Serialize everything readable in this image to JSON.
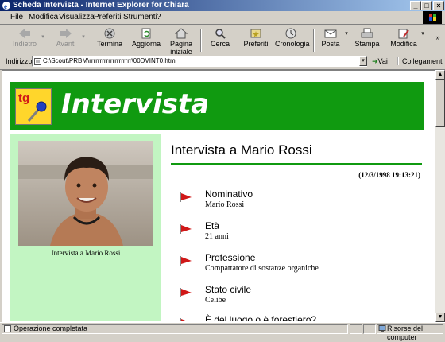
{
  "window": {
    "title": "Scheda Intervista - Internet Explorer for Chiara"
  },
  "menu": [
    "File",
    "Modifica",
    "Visualizza",
    "Preferiti",
    "Strumenti",
    "?"
  ],
  "toolbar": {
    "back": "Indietro",
    "forward": "Avanti",
    "stop": "Termina",
    "refresh": "Aggiorna",
    "home_line1": "Pagina",
    "home_line2": "iniziale",
    "search": "Cerca",
    "favorites": "Preferiti",
    "history": "Cronologia",
    "mail": "Posta",
    "print": "Stampa",
    "edit": "Modifica"
  },
  "address": {
    "label": "Indirizzo",
    "url": "C:\\Scout\\PRBM\\rrrrrrrrrrrrrrrrrrrr\\00DVINT0.htm",
    "go": "Vai",
    "links": "Collegamenti"
  },
  "page": {
    "banner_title": "Intervista",
    "logo_text": "tg",
    "photo_caption": "Intervista a Mario Rossi",
    "heading": "Intervista a Mario Rossi",
    "timestamp": "(12/3/1998 19:13:21)",
    "fields": [
      {
        "label": "Nominativo",
        "value": "Mario Rossi"
      },
      {
        "label": "Età",
        "value": "21 anni"
      },
      {
        "label": "Professione",
        "value": "Compattatore di sostanze organiche"
      },
      {
        "label": "Stato civile",
        "value": "Celibe"
      },
      {
        "label": "È del luogo o è forestiero?",
        "value": ""
      }
    ]
  },
  "status": {
    "text": "Operazione completata",
    "zone": "Risorse del computer"
  },
  "colors": {
    "banner": "#109a10",
    "sidebar": "#c2f5c2",
    "flag": "#d01818",
    "titlebar": "#0a246a"
  }
}
